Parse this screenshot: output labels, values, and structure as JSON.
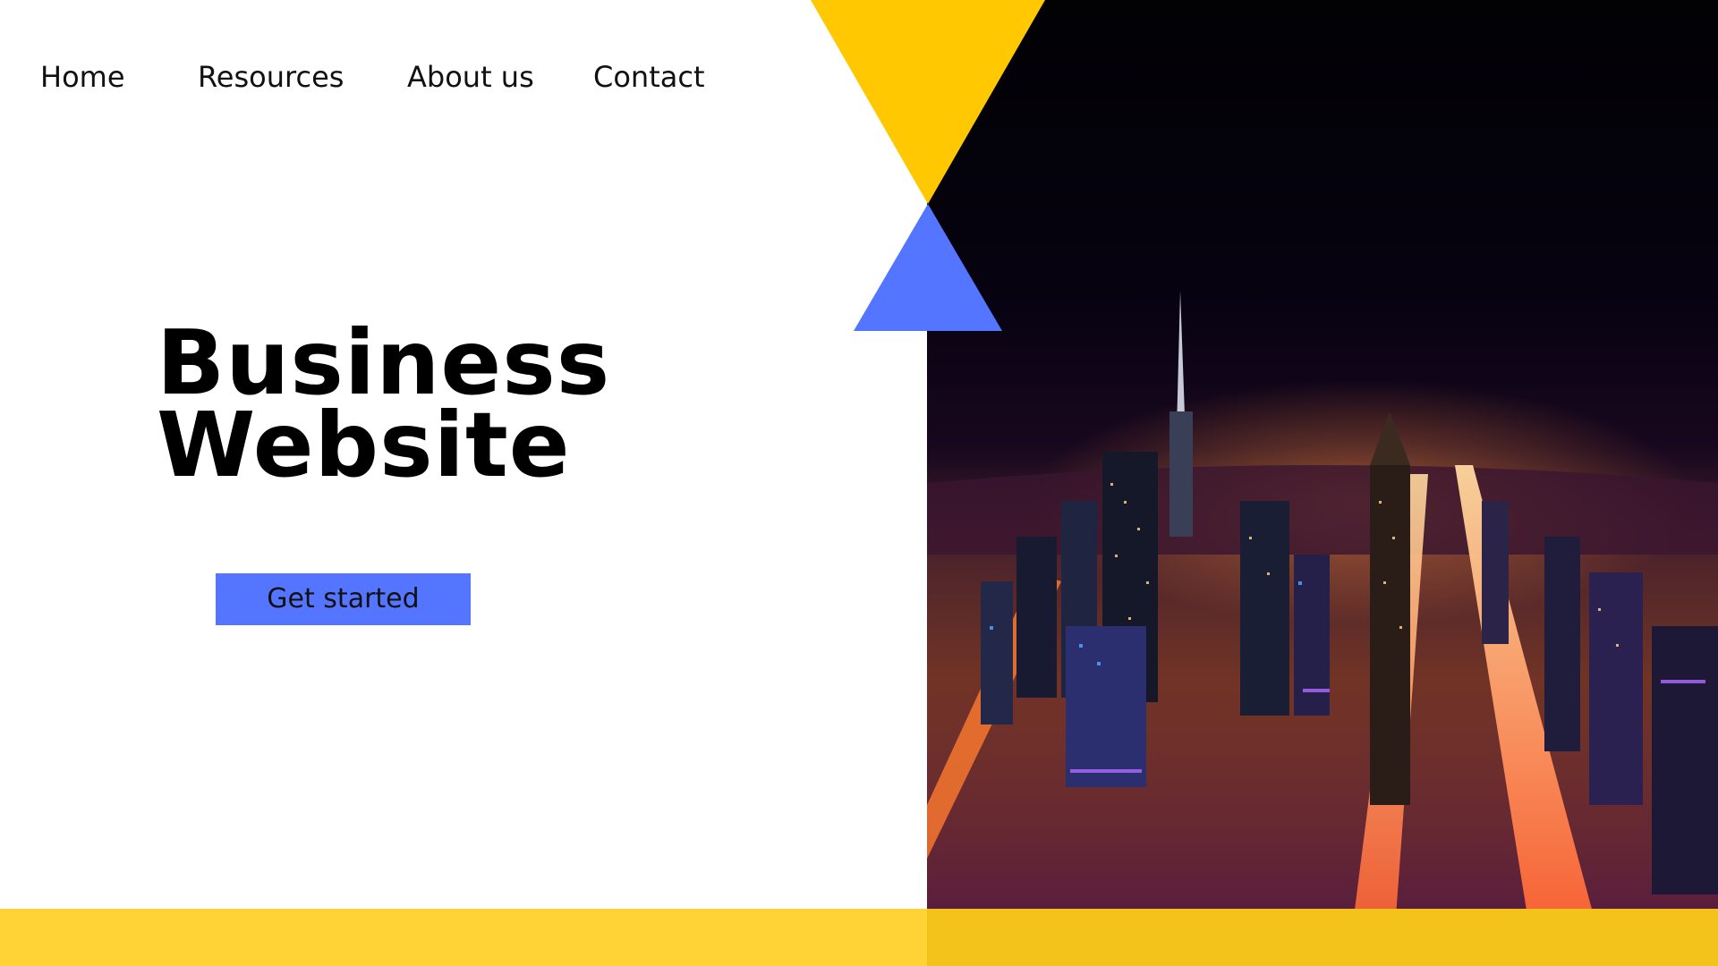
{
  "nav": {
    "items": [
      {
        "label": "Home"
      },
      {
        "label": "Resources"
      },
      {
        "label": "About us"
      },
      {
        "label": "Contact"
      }
    ]
  },
  "hero": {
    "title_line1": "Business",
    "title_line2": "Website",
    "cta_label": "Get started"
  },
  "colors": {
    "accent_yellow": "#FFC800",
    "band_yellow": "#FFD335",
    "accent_blue": "#5375FF",
    "text": "#000000",
    "background": "#FFFFFF"
  },
  "photo": {
    "subject": "city-skyline-at-night-image"
  }
}
